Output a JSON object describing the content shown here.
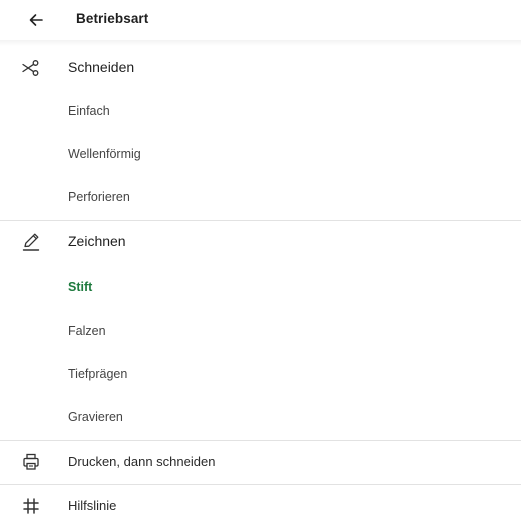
{
  "header": {
    "title": "Betriebsart",
    "back_icon": "arrow-left-icon"
  },
  "colors": {
    "selected": "#1e7a3e",
    "divider": "#e2e2e2",
    "text": "#222222"
  },
  "groups": {
    "cut": {
      "label": "Schneiden",
      "icon": "scissors-icon",
      "items": [
        "Einfach",
        "Wellenförmig",
        "Perforieren"
      ]
    },
    "draw": {
      "label": "Zeichnen",
      "icon": "pencil-icon",
      "items": [
        "Stift",
        "Falzen",
        "Tiefprägen",
        "Gravieren"
      ],
      "selected": "Stift"
    },
    "print": {
      "label": "Drucken, dann schneiden",
      "icon": "printer-icon"
    },
    "guide": {
      "label": "Hilfslinie",
      "icon": "grid-hash-icon"
    }
  }
}
